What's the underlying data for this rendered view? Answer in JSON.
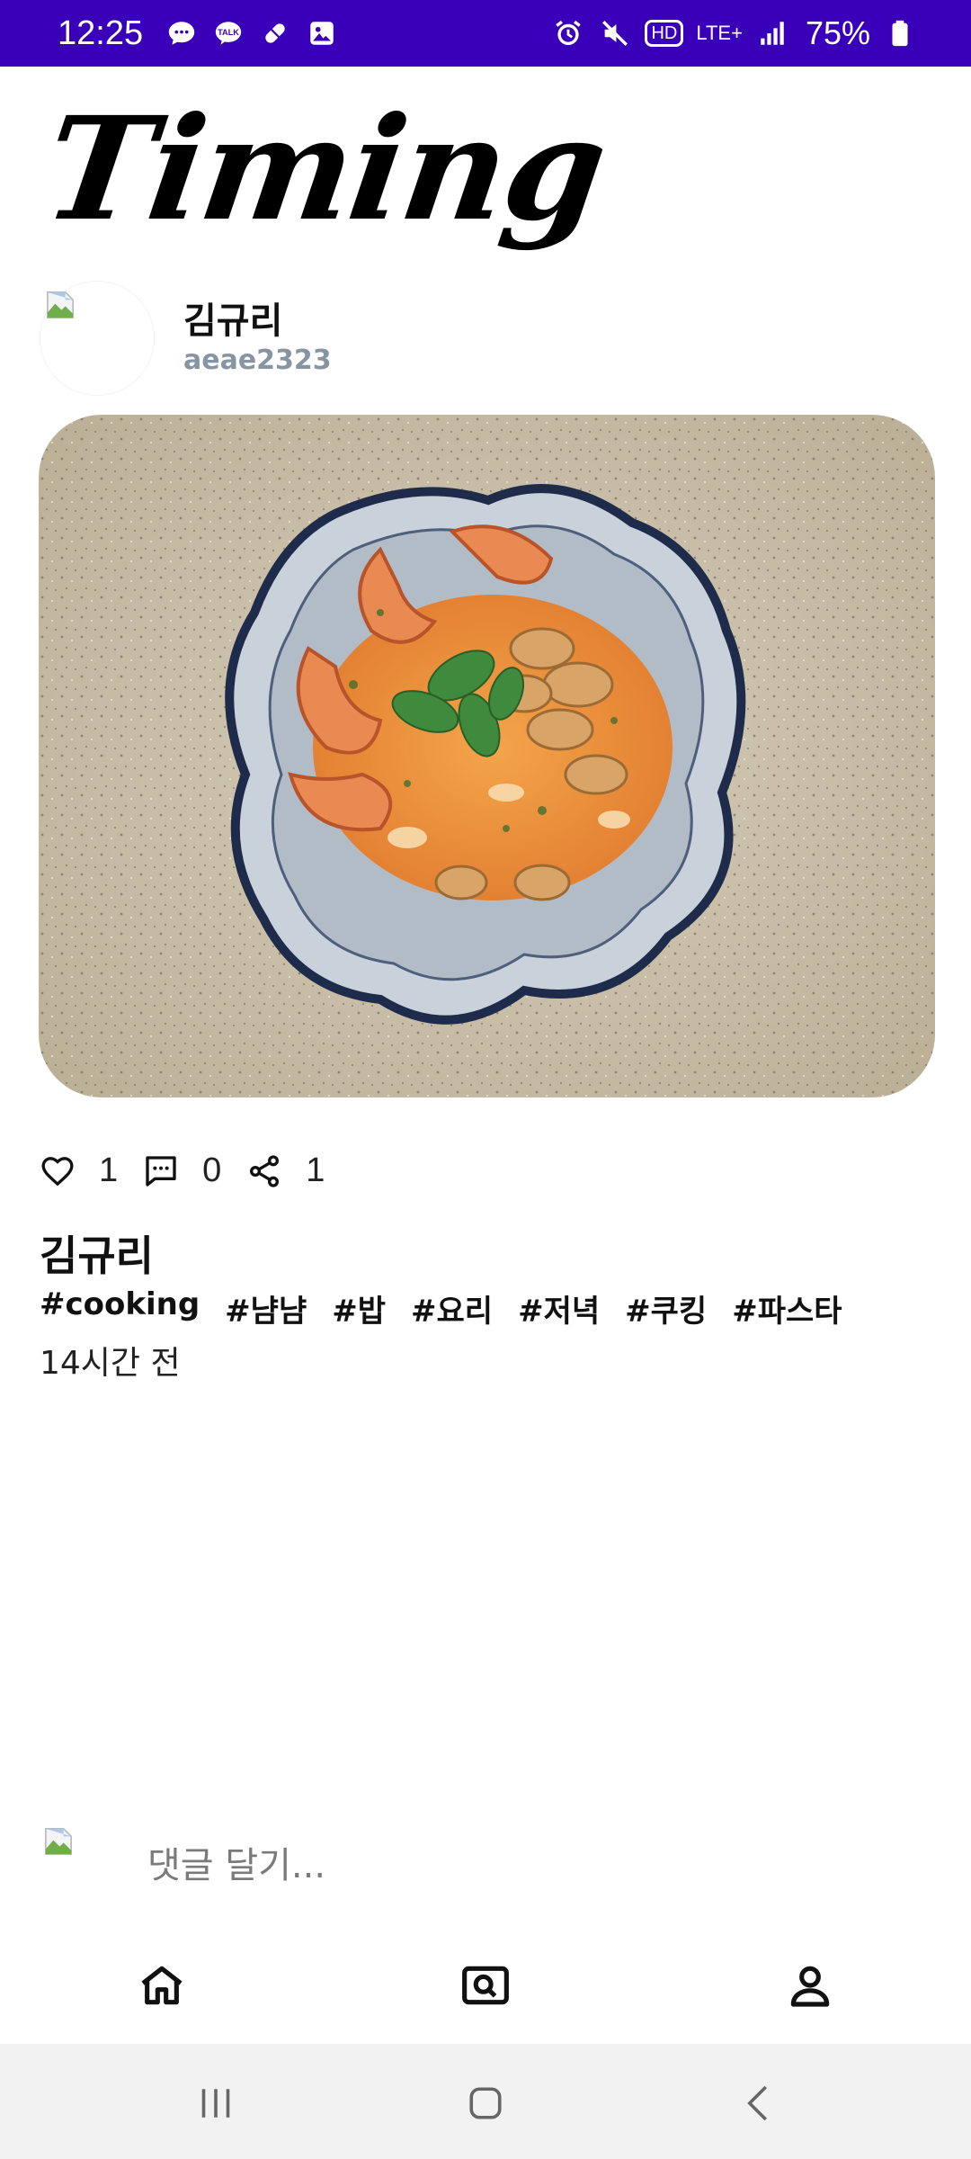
{
  "status_bar": {
    "time": "12:25",
    "left_icons": [
      "chat-bubble-icon",
      "kakaotalk-icon",
      "pill-icon",
      "gallery-icon"
    ],
    "right_icons": [
      "alarm-icon",
      "mute-icon",
      "hd-icon",
      "lte-icon",
      "signal-icon",
      "battery-icon"
    ],
    "hd_label": "HD",
    "lte_label": "LTE+",
    "battery": "75%",
    "background": "#3a00b9"
  },
  "app": {
    "logo": "Timing"
  },
  "author": {
    "name": "김규리",
    "handle": "aeae2323"
  },
  "post": {
    "image_icon": "pasta-photo",
    "likes": "1",
    "comments": "0",
    "shares": "1",
    "author_name": "김규리",
    "tags": [
      "#cooking",
      "#냠냠",
      "#밥",
      "#요리",
      "#저녁",
      "#쿠킹",
      "#파스타"
    ],
    "time_ago": "14시간 전"
  },
  "comment": {
    "placeholder": "댓글 달기..."
  },
  "bottom_nav": [
    "home-icon",
    "search-icon",
    "profile-icon"
  ],
  "system_nav": [
    "recent-apps-icon",
    "home-button-icon",
    "back-icon"
  ]
}
